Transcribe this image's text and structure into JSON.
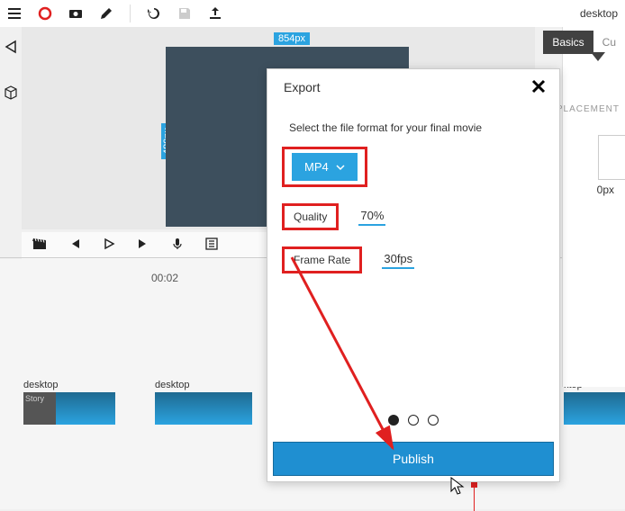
{
  "toolbar": {
    "right_label": "desktop"
  },
  "canvas": {
    "width_label": "854px",
    "height_label": "480px"
  },
  "timeline": {
    "time": "00:02",
    "clip_label_1": "desktop",
    "clip_label_2": "desktop",
    "clip_label_3": "ktop",
    "story_label": "Story"
  },
  "right_panel": {
    "tab_basics": "Basics",
    "tab_custom": "Cu",
    "placement": "PLACEMENT",
    "px": "0px"
  },
  "modal": {
    "title": "Export",
    "prompt": "Select the file format for your final movie",
    "format_label": "MP4",
    "quality_label": "Quality",
    "quality_value": "70%",
    "framerate_label": "Frame Rate",
    "framerate_value": "30fps",
    "publish_label": "Publish"
  }
}
